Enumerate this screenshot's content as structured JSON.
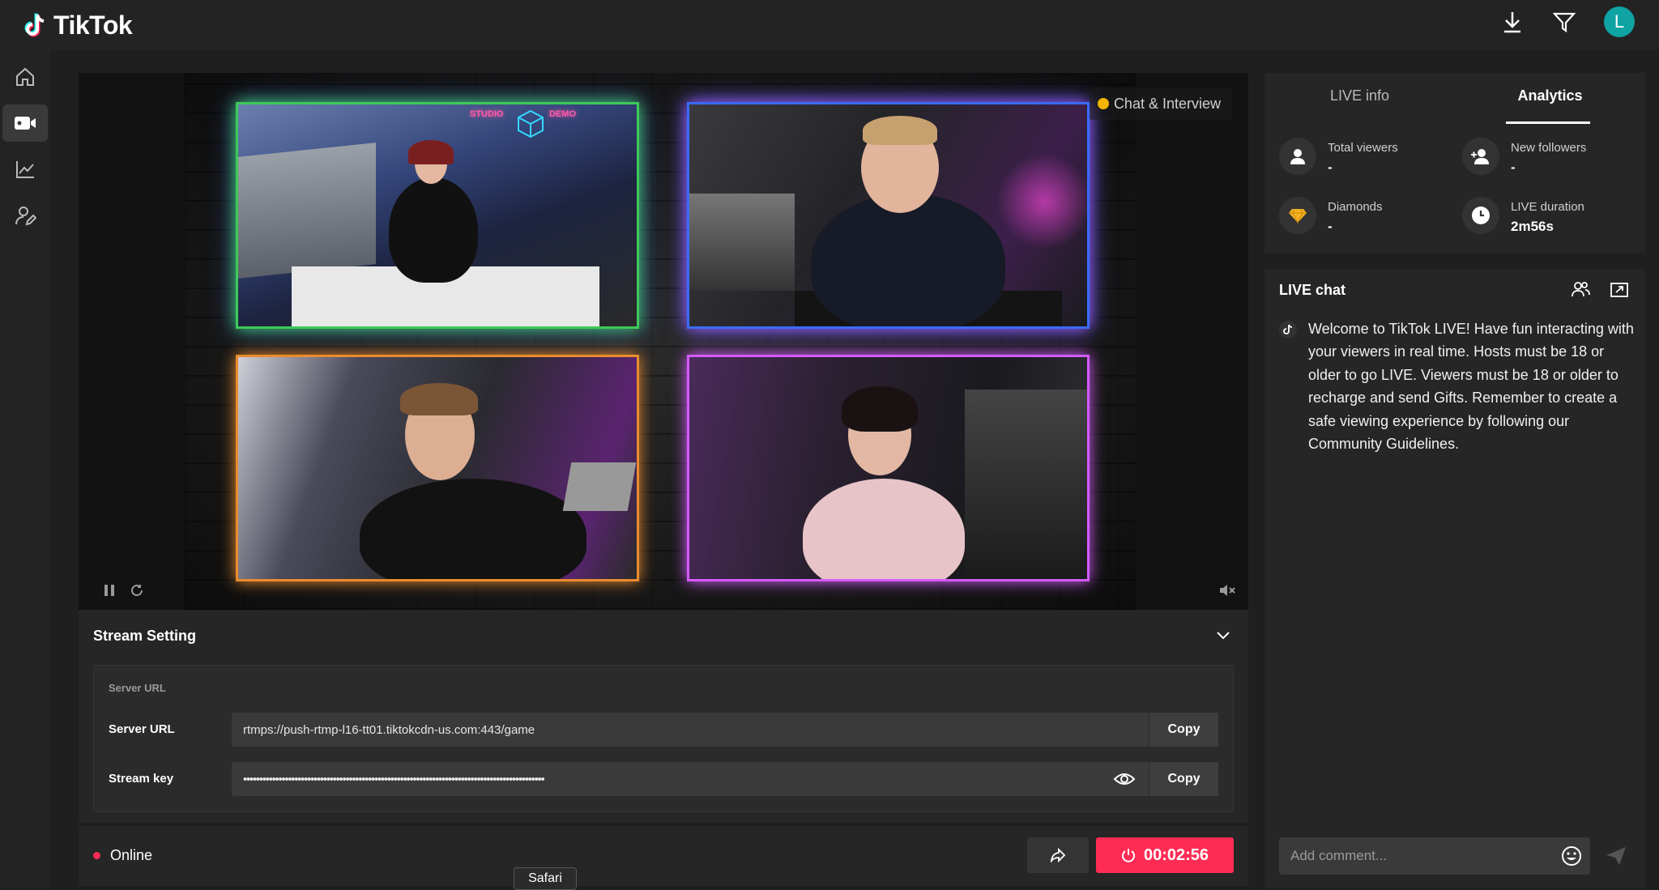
{
  "app": {
    "name": "TikTok"
  },
  "topbar": {
    "download_icon": "download-icon",
    "filter_icon": "filter-icon",
    "avatar_letter": "L",
    "avatar_color": "#0fa3a3"
  },
  "sidebar": {
    "items": [
      {
        "icon": "home-icon",
        "active": false
      },
      {
        "icon": "video-camera-icon",
        "active": true
      },
      {
        "icon": "chart-icon",
        "active": false
      },
      {
        "icon": "user-edit-icon",
        "active": false
      }
    ]
  },
  "video": {
    "overlay_label": "Chat & Interview",
    "pause_icon": "pause-icon",
    "refresh_icon": "refresh-icon",
    "mute_icon": "mute-icon",
    "studio_sign_left": "STUDIO",
    "studio_sign_right": "DEMO"
  },
  "stream_setting": {
    "title": "Stream Setting",
    "box_title": "Server URL",
    "server_url_label": "Server URL",
    "server_url_value": "rtmps://push-rtmp-l16-tt01.tiktokcdn-us.com:443/game",
    "stream_key_label": "Stream key",
    "stream_key_value": "••••••••••••••••••••••••••••••••••••••••••••••••••••••••••••••••••••••••••••••••••••••••••••••",
    "copy_label": "Copy"
  },
  "bottombar": {
    "status": "Online",
    "timer": "00:02:56",
    "status_color": "#fe2c55"
  },
  "tooltip": {
    "text": "Safari"
  },
  "info_panel": {
    "tabs": [
      {
        "label": "LIVE info",
        "active": false
      },
      {
        "label": "Analytics",
        "active": true
      }
    ],
    "stats": [
      {
        "label": "Total viewers",
        "value": "-",
        "icon": "user-icon"
      },
      {
        "label": "New followers",
        "value": "-",
        "icon": "add-user-icon"
      },
      {
        "label": "Diamonds",
        "value": "-",
        "icon": "diamond-icon"
      },
      {
        "label": "LIVE duration",
        "value": "2m56s",
        "icon": "clock-icon"
      }
    ]
  },
  "chat": {
    "title": "LIVE chat",
    "message": "Welcome to TikTok LIVE! Have fun interacting with your viewers in real time. Hosts must be 18 or older to go LIVE. Viewers must be 18 or older to recharge and send Gifts. Remember to create a safe viewing experience by following our Community Guidelines.",
    "comment_placeholder": "Add comment..."
  }
}
